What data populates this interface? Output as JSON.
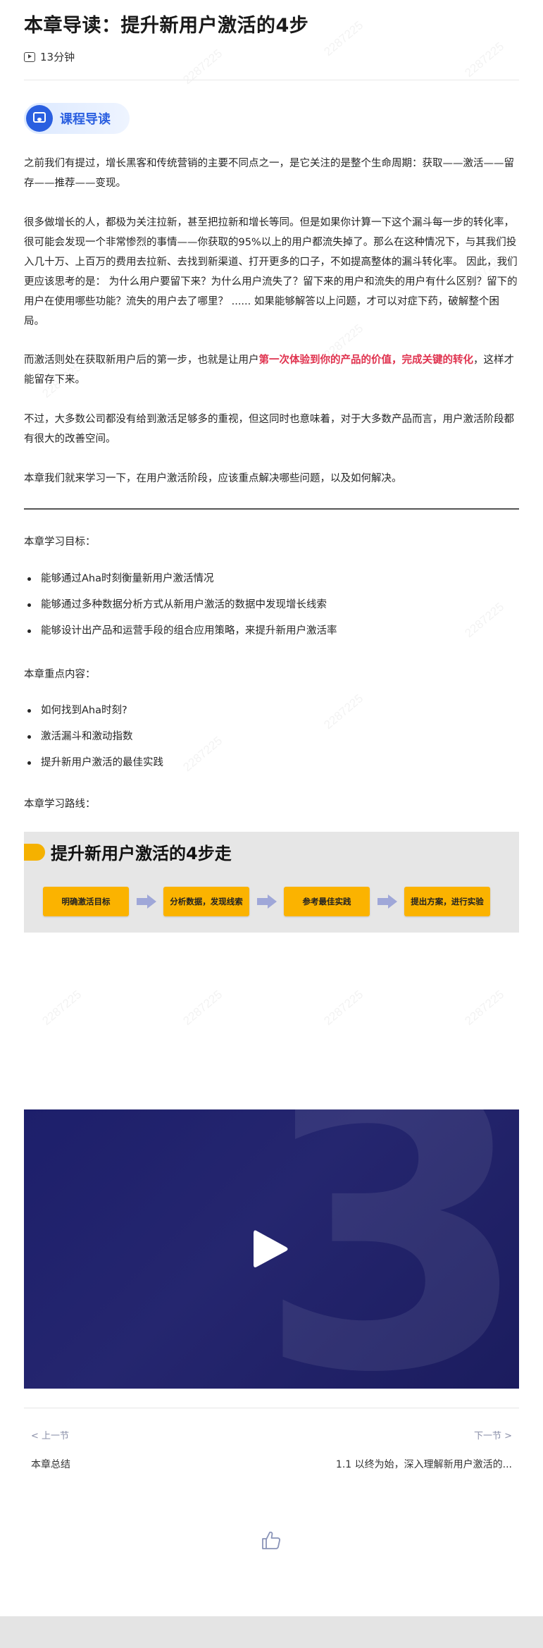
{
  "header": {
    "title": "本章导读：提升新用户激活的4步",
    "duration": "13分钟"
  },
  "guide": {
    "label": "课程导读"
  },
  "intro": {
    "p1": "之前我们有提过，增长黑客和传统营销的主要不同点之一，是它关注的是整个生命周期：获取——激活——留存——推荐——变现。",
    "p2": "很多做增长的人，都极为关注拉新，甚至把拉新和增长等同。但是如果你计算一下这个漏斗每一步的转化率，很可能会发现一个非常惨烈的事情——你获取的95%以上的用户都流失掉了。那么在这种情况下，与其我们投入几十万、上百万的费用去拉新、去找到新渠道、打开更多的口子，不如提高整体的漏斗转化率。 因此，我们更应该思考的是： 为什么用户要留下来？为什么用户流失了？留下来的用户和流失的用户有什么区别？留下的用户在使用哪些功能？流失的用户去了哪里？ ...... 如果能够解答以上问题，才可以对症下药，破解整个困局。",
    "p3_before": "而激活则处在获取新用户后的第一步，也就是让用户",
    "p3_highlight": "第一次体验到你的产品的价值，完成关键的转化",
    "p3_after": "，这样才能留存下来。",
    "p4": "不过，大多数公司都没有给到激活足够多的重视，但这同时也意味着，对于大多数产品而言，用户激活阶段都有很大的改善空间。",
    "p5": "本章我们就来学习一下，在用户激活阶段，应该重点解决哪些问题，以及如何解决。"
  },
  "goals": {
    "heading": "本章学习目标：",
    "items": [
      "能够通过Aha时刻衡量新用户激活情况",
      "能够通过多种数据分析方式从新用户激活的数据中发现增长线索",
      "能够设计出产品和运营手段的组合应用策略，来提升新用户激活率"
    ]
  },
  "keypoints": {
    "heading": "本章重点内容：",
    "items": [
      "如何找到Aha时刻?",
      "激活漏斗和激动指数",
      "提升新用户激活的最佳实践"
    ]
  },
  "route": {
    "heading": "本章学习路线：",
    "title": "提升新用户激活的4步走",
    "steps": [
      "明确激活目标",
      "分析数据，发现线索",
      "参考最佳实践",
      "提出方案，进行实验"
    ]
  },
  "nav": {
    "prev_label": "< 上一节",
    "prev_title": "本章总结",
    "next_label": "下一节 >",
    "next_title": "1.1 以终为始，深入理解新用户激活的..."
  },
  "watermark": "2287225",
  "colors": {
    "accent": "#2a5fe0",
    "highlight": "#e0334f",
    "step_fill": "#fbb300",
    "video_bg": "#1d1f6b"
  },
  "icons": {
    "duration": "video-play-icon",
    "guide": "course-guide-icon",
    "video": "play-icon",
    "like": "thumbs-up-icon"
  }
}
